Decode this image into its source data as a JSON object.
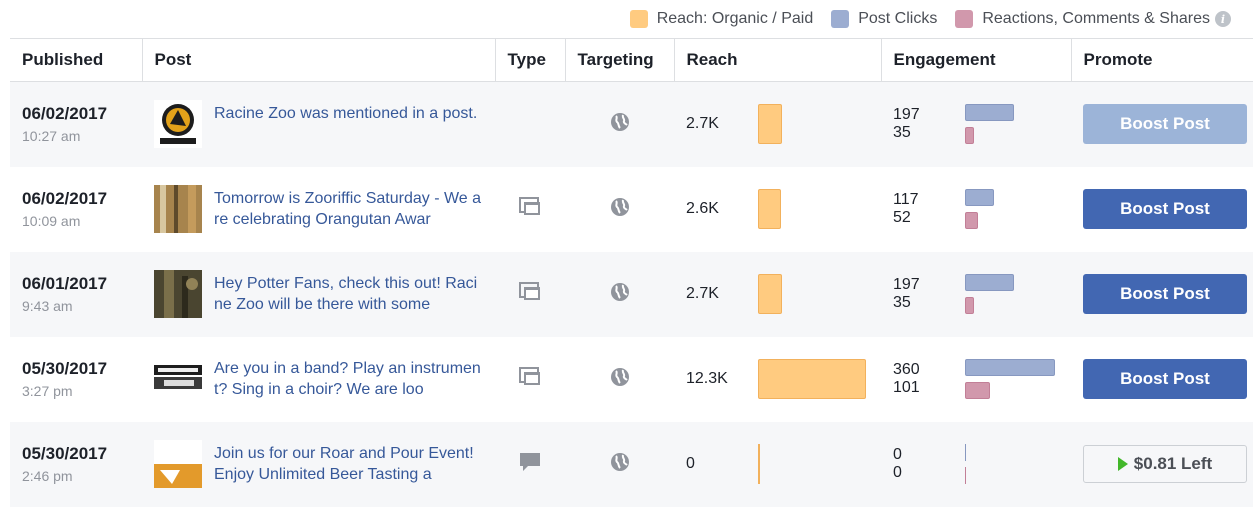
{
  "legend": {
    "reach_label": "Reach: Organic / Paid",
    "clicks_label": "Post Clicks",
    "reactions_label": "Reactions, Comments & Shares",
    "reach_color": "#ffcb80",
    "clicks_color": "#9cadd1",
    "reactions_color": "#d198ac"
  },
  "headers": {
    "published": "Published",
    "post": "Post",
    "type": "Type",
    "targeting": "Targeting",
    "reach": "Reach",
    "engagement": "Engagement",
    "promote": "Promote"
  },
  "rows": [
    {
      "date": "06/02/2017",
      "time": "10:27 am",
      "post": "Racine Zoo was mentioned in a post.",
      "thumb_text": "RACINE ZOO",
      "type_icon": "none",
      "reach": "2.7K",
      "reach_value": 2.7,
      "clicks": "197",
      "clicks_value": 197,
      "reactions": "35",
      "reactions_value": 35,
      "promote": "Boost Post",
      "promote_state": "disabled"
    },
    {
      "date": "06/02/2017",
      "time": "10:09 am",
      "post": "Tomorrow is Zooriffic Saturday - We are celebrating Orangutan Awar",
      "thumb_text": "",
      "type_icon": "album-icon",
      "reach": "2.6K",
      "reach_value": 2.6,
      "clicks": "117",
      "clicks_value": 117,
      "reactions": "52",
      "reactions_value": 52,
      "promote": "Boost Post",
      "promote_state": "active"
    },
    {
      "date": "06/01/2017",
      "time": "9:43 am",
      "post": "Hey Potter Fans, check this out! Racine Zoo will be there with some",
      "thumb_text": "",
      "type_icon": "album-icon",
      "reach": "2.7K",
      "reach_value": 2.7,
      "clicks": "197",
      "clicks_value": 197,
      "reactions": "35",
      "reactions_value": 35,
      "promote": "Boost Post",
      "promote_state": "active"
    },
    {
      "date": "05/30/2017",
      "time": "3:27 pm",
      "post": "Are you in a band? Play an instrument? Sing in a choir? We are loo",
      "thumb_text": "MUSICIA WANT",
      "type_icon": "album-icon",
      "reach": "12.3K",
      "reach_value": 12.3,
      "clicks": "360",
      "clicks_value": 360,
      "reactions": "101",
      "reactions_value": 101,
      "promote": "Boost Post",
      "promote_state": "active"
    },
    {
      "date": "05/30/2017",
      "time": "2:46 pm",
      "post": "Join us for our Roar and Pour Event! Enjoy Unlimited Beer Tasting a",
      "thumb_text": "",
      "type_icon": "comment-icon",
      "reach": "0",
      "reach_value": 0,
      "clicks": "0",
      "clicks_value": 0,
      "reactions": "0",
      "reactions_value": 0,
      "promote": "$0.81 Left",
      "promote_state": "budget"
    }
  ]
}
